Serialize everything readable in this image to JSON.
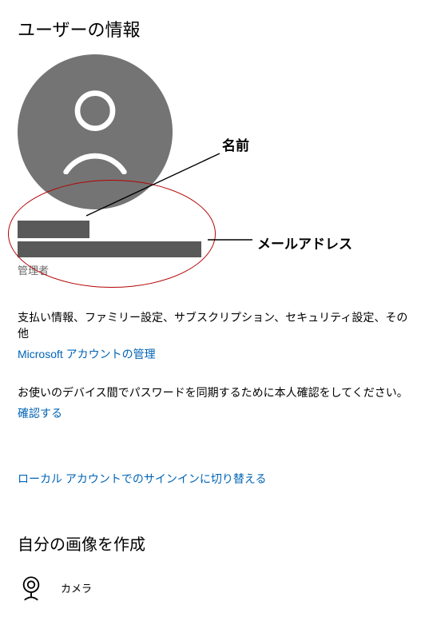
{
  "page": {
    "title": "ユーザーの情報"
  },
  "user": {
    "name_redacted": true,
    "email_redacted": true,
    "role": "管理者"
  },
  "account": {
    "description": "支払い情報、ファミリー設定、サブスクリプション、セキュリティ設定、その他",
    "manage_link": "Microsoft アカウントの管理"
  },
  "verify": {
    "prompt": "お使いのデバイス間でパスワードを同期するために本人確認をしてください。",
    "link": "確認する"
  },
  "local_signin": {
    "link": "ローカル アカウントでのサインインに切り替える"
  },
  "picture": {
    "section_title": "自分の画像を作成",
    "camera_label": "カメラ"
  },
  "annotations": {
    "name_label": "名前",
    "mail_label": "メールアドレス"
  }
}
